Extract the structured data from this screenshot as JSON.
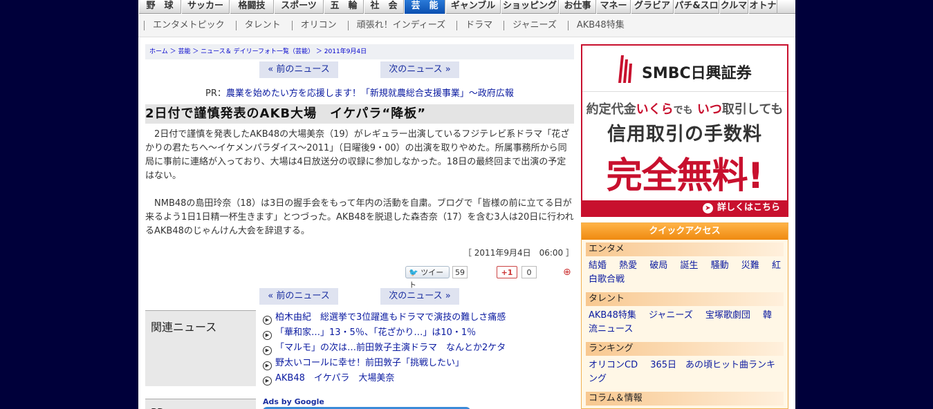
{
  "topnav": [
    {
      "label": "野　球",
      "w": 62
    },
    {
      "label": "サッカー",
      "w": 70
    },
    {
      "label": "格闘技",
      "w": 64
    },
    {
      "label": "スポーツ",
      "w": 72
    },
    {
      "label": "五　輪",
      "w": 58
    },
    {
      "label": "社　会",
      "w": 58
    },
    {
      "label": "芸　能",
      "w": 60,
      "active": true
    },
    {
      "label": "ギャンブル",
      "w": 80
    },
    {
      "label": "ショッピング",
      "w": 84
    },
    {
      "label": "お仕事",
      "w": 54
    },
    {
      "label": "マネー",
      "w": 50
    },
    {
      "label": "グラビア",
      "w": 62
    },
    {
      "label": "パチ&スロ",
      "w": 66
    },
    {
      "label": "クルマ",
      "w": 42
    },
    {
      "label": "オトナ",
      "w": 42
    }
  ],
  "subnav": [
    "エンタメトピック",
    "タレント",
    "オリコン",
    "頑張れ！インディーズ",
    "ドラマ",
    "ジャニーズ",
    "AKB48特集"
  ],
  "breadcrumb": "ホーム ＞ 芸能 ＞ ニュース＆ デイリーフォト一覧（芸能） ＞ 2011年9月4日",
  "pager": {
    "prev": "« 前のニュース",
    "next": "次のニュース »"
  },
  "pr": {
    "prefix": "PR：",
    "text": "農業を始めたい方を応援します！「新規就農総合支援事業」～政府広報"
  },
  "article": {
    "headline": "2日付で謹慎発表のAKB大場　イケパラ“降板”",
    "paragraphs": [
      "　2日付で謹慎を発表したAKB48の大場美奈（19）がレギュラー出演しているフジテレビ系ドラマ「花ざかりの君たちへ～イケメンパラダイス～2011」（日曜後9・00）の出演を取りやめた。所属事務所から同局に事前に連絡が入っており、大場は4日放送分の収録に参加しなかった。18日の最終回まで出演の予定はない。",
      "　NMB48の島田玲奈（18）は3日の握手会をもって年内の活動を自粛。ブログで「皆様の前に立てる日が来るよう1日1日精一杯生きます」とつづった。AKB48を脱退した森杏奈（17）を含む3人は20日に行われるAKB48のじゃんけん大会を辞退する。"
    ],
    "dateline": "［ 2011年9月4日　06:00 ］"
  },
  "social": {
    "tweet_label": "ツイート",
    "tweet_count": "59",
    "gplus_label": "+1",
    "gplus_count": "0"
  },
  "related": {
    "label": "関連ニュース",
    "items": [
      "柏木由紀　総選挙で3位躍進もドラマで演技の難しさ痛感",
      "「華和家…」13・5％、「花ざかり…」は10・1％",
      "「マルモ」の次は…前田敦子主演ドラマ　なんとか2ケタ",
      "野太いコールに幸せ！前田敦子「挑戦したい」",
      "AKB48　イケパラ　大場美奈"
    ]
  },
  "pr_box": {
    "label": "PR"
  },
  "ads": {
    "label": "Ads by Google"
  },
  "banner": {
    "logo": "SMBC日興証券",
    "line1_a": "約定代金",
    "line1_b": "いくら",
    "line1_c": "でも",
    "line1_d": "いつ",
    "line1_e": "取引しても",
    "line2": "信用取引の手数料",
    "line3": "完全無料!",
    "cta": "詳しくはこちら",
    "brand_color": "#c8102e"
  },
  "quick": {
    "title": "クイックアクセス",
    "sections": [
      {
        "head": "エンタメ",
        "links": [
          "結婚",
          "熱愛",
          "破局",
          "誕生",
          "騒動",
          "災難",
          "紅白歌合戦"
        ]
      },
      {
        "head": "タレント",
        "links": [
          "AKB48特集",
          "ジャニーズ",
          "宝塚歌劇団",
          "韓流ニュース"
        ]
      },
      {
        "head": "ランキング",
        "links": [
          "オリコンCD",
          "365日　あの頃ヒット曲ランキング"
        ]
      },
      {
        "head": "コラム＆情報",
        "links": []
      }
    ]
  }
}
